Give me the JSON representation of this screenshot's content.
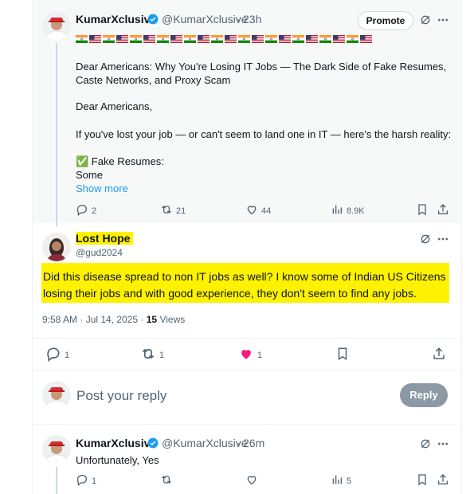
{
  "post1": {
    "author_name": "KumarXclusive",
    "handle": "@KumarXclusive",
    "time": "23h",
    "promote_label": "Promote",
    "title_line": "Dear Americans: Why You're Losing IT Jobs — The Dark Side of Fake Resumes, Caste Networks, and Proxy Scam",
    "greeting": "Dear Americans,",
    "intro": "If you've lost your job — or can't seem to land one in IT — here's the harsh reality:",
    "bullet": "✅ Fake Resumes:",
    "truncated": "Some",
    "show_more": "Show more",
    "replies": "2",
    "reposts": "21",
    "likes": "44",
    "views": "8.9K"
  },
  "post2": {
    "author_name": "Lost Hope",
    "handle": "@gud2024",
    "text_line1": "Did this disease spread to non IT jobs as well? I know some of Indian US Citizens",
    "text_line2": "losing their jobs and with good experience, they don't seem to find any jobs.",
    "timestamp": "9:58 AM · Jul 14, 2025 · ",
    "views_count": "15",
    "views_label": " Views",
    "replies": "1",
    "reposts": "1",
    "likes": "1"
  },
  "reply_box": {
    "placeholder": "Post your reply",
    "button_label": "Reply"
  },
  "post3": {
    "author_name": "KumarXclusive",
    "handle": "@KumarXclusive",
    "time": "26m",
    "text": "Unfortunately, Yes",
    "replies": "1",
    "views": "5"
  },
  "colors": {
    "highlight": "#fff200",
    "like_active": "#f91880",
    "verified": "#1d9bf0",
    "link": "#1d9bf0"
  }
}
